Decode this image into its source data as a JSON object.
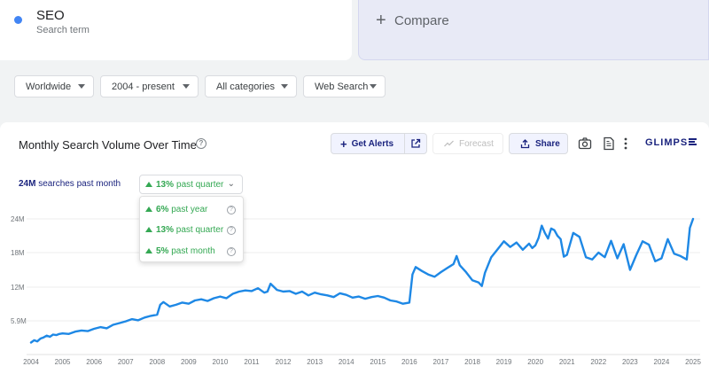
{
  "search_term": {
    "name": "SEO",
    "subtitle": "Search term",
    "color": "#4285f4"
  },
  "compare": {
    "label": "Compare"
  },
  "filters": [
    {
      "label": "Worldwide"
    },
    {
      "label": "2004 - present"
    },
    {
      "label": "All categories"
    },
    {
      "label": "Web Search"
    }
  ],
  "header": {
    "title": "Monthly Search Volume Over Time",
    "get_alerts": "Get Alerts",
    "forecast": "Forecast",
    "share": "Share",
    "logo": "GLIMPSE"
  },
  "stats": {
    "main_value": "24M",
    "main_rest": "searches past month",
    "selected_value": "13%",
    "selected_rest": "past quarter",
    "options": [
      {
        "value": "6%",
        "rest": "past year"
      },
      {
        "value": "13%",
        "rest": "past quarter"
      },
      {
        "value": "5%",
        "rest": "past month"
      }
    ]
  },
  "chart_data": {
    "type": "line",
    "title": "Monthly Search Volume Over Time",
    "xlabel": "",
    "ylabel": "",
    "x_ticks": [
      "2004",
      "2005",
      "2006",
      "2007",
      "2008",
      "2009",
      "2010",
      "2011",
      "2012",
      "2013",
      "2014",
      "2015",
      "2016",
      "2017",
      "2018",
      "2019",
      "2020",
      "2021",
      "2022",
      "2023",
      "2024",
      "2025"
    ],
    "y_ticks": [
      "5.9M",
      "12M",
      "18M",
      "24M"
    ],
    "y_tick_values": [
      5.9,
      12,
      18,
      24
    ],
    "y_unit": "M",
    "ylim": [
      0,
      26
    ],
    "xlim": [
      2004,
      2025
    ],
    "grid": true,
    "color": "#1e88e5",
    "series": [
      {
        "x": [
          2004.0,
          2004.1,
          2004.2,
          2004.3,
          2004.4,
          2004.5,
          2004.6,
          2004.7,
          2004.8,
          2004.9,
          2005.0,
          2005.2,
          2005.4,
          2005.6,
          2005.8,
          2006.0,
          2006.2,
          2006.4,
          2006.6,
          2006.8,
          2007.0,
          2007.2,
          2007.4,
          2007.6,
          2007.8,
          2008.0,
          2008.1,
          2008.2,
          2008.4,
          2008.6,
          2008.8,
          2009.0,
          2009.2,
          2009.4,
          2009.6,
          2009.8,
          2010.0,
          2010.2,
          2010.4,
          2010.6,
          2010.8,
          2011.0,
          2011.2,
          2011.4,
          2011.5,
          2011.6,
          2011.8,
          2012.0,
          2012.2,
          2012.4,
          2012.6,
          2012.8,
          2013.0,
          2013.2,
          2013.4,
          2013.6,
          2013.8,
          2014.0,
          2014.2,
          2014.4,
          2014.6,
          2014.8,
          2015.0,
          2015.2,
          2015.4,
          2015.6,
          2015.8,
          2016.0,
          2016.1,
          2016.2,
          2016.4,
          2016.6,
          2016.8,
          2017.0,
          2017.2,
          2017.4,
          2017.5,
          2017.6,
          2017.8,
          2018.0,
          2018.2,
          2018.3,
          2018.4,
          2018.6,
          2018.8,
          2019.0,
          2019.2,
          2019.4,
          2019.6,
          2019.8,
          2019.9,
          2020.0,
          2020.1,
          2020.2,
          2020.3,
          2020.4,
          2020.5,
          2020.6,
          2020.7,
          2020.8,
          2020.9,
          2021.0,
          2021.2,
          2021.4,
          2021.6,
          2021.8,
          2022.0,
          2022.2,
          2022.4,
          2022.6,
          2022.8,
          2023.0,
          2023.2,
          2023.4,
          2023.6,
          2023.8,
          2024.0,
          2024.2,
          2024.4,
          2024.6,
          2024.8,
          2024.9,
          2025.0
        ],
        "y": [
          2.1,
          2.5,
          2.3,
          2.8,
          3.0,
          3.3,
          3.1,
          3.5,
          3.4,
          3.6,
          3.7,
          3.6,
          4.0,
          4.2,
          4.1,
          4.5,
          4.8,
          4.6,
          5.2,
          5.5,
          5.8,
          6.2,
          6.0,
          6.5,
          6.8,
          7.0,
          8.8,
          9.3,
          8.5,
          8.8,
          9.2,
          9.0,
          9.6,
          9.8,
          9.5,
          10.0,
          10.3,
          10.0,
          10.8,
          11.2,
          11.4,
          11.3,
          11.8,
          11.0,
          11.2,
          12.6,
          11.5,
          11.2,
          11.3,
          10.8,
          11.2,
          10.5,
          11.0,
          10.7,
          10.5,
          10.2,
          10.9,
          10.6,
          10.1,
          10.3,
          9.9,
          10.2,
          10.4,
          10.1,
          9.6,
          9.4,
          9.0,
          9.2,
          14.2,
          15.5,
          14.8,
          14.2,
          13.8,
          14.6,
          15.3,
          16.0,
          17.4,
          15.8,
          14.6,
          13.2,
          12.8,
          12.2,
          14.5,
          17.2,
          18.6,
          20.0,
          19.0,
          19.8,
          18.5,
          19.6,
          18.8,
          19.3,
          20.6,
          22.8,
          21.5,
          20.5,
          22.3,
          22.0,
          21.0,
          20.4,
          17.3,
          17.6,
          21.5,
          20.8,
          17.2,
          16.8,
          18.0,
          17.2,
          20.1,
          17.0,
          19.5,
          15.0,
          17.6,
          20.0,
          19.4,
          16.5,
          17.0,
          20.4,
          17.8,
          17.4,
          16.8,
          22.4,
          24.0
        ]
      }
    ]
  }
}
